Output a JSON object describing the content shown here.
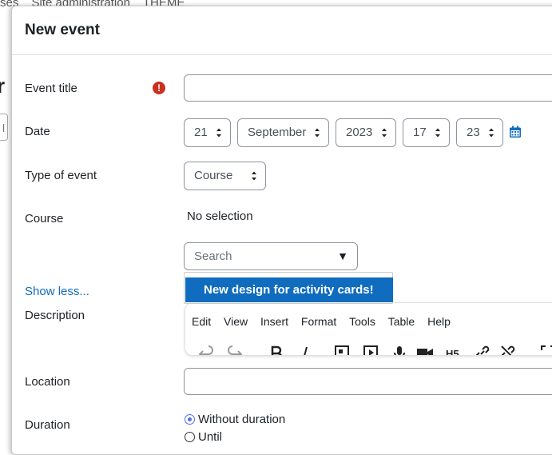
{
  "background": {
    "nav_items": [
      "ses",
      "Site administration",
      "THEME"
    ],
    "heading_fragment": "r",
    "box_fragment": "l c"
  },
  "modal": {
    "title": "New event",
    "event_title": {
      "label": "Event title",
      "value": "",
      "required_icon": "exclamation-circle-icon"
    },
    "date": {
      "label": "Date",
      "day": "21",
      "month": "September",
      "year": "2023",
      "hour": "17",
      "minute": "23",
      "calendar_icon": "calendar-icon"
    },
    "type_of_event": {
      "label": "Type of event",
      "value": "Course"
    },
    "course": {
      "label": "Course",
      "selection_text": "No selection",
      "search_placeholder": "Search",
      "dropdown_arrow": "▼",
      "suggestion": "New design for activity cards!"
    },
    "show_less": "Show less...",
    "description": {
      "label": "Description",
      "menu": [
        "Edit",
        "View",
        "Insert",
        "Format",
        "Tools",
        "Table",
        "Help"
      ]
    },
    "location": {
      "label": "Location",
      "value": ""
    },
    "duration": {
      "label": "Duration",
      "options": [
        {
          "label": "Without duration",
          "checked": true
        },
        {
          "label": "Until",
          "checked": false
        }
      ]
    }
  },
  "colors": {
    "link": "#0f6cbf",
    "selection_bg": "#0f6cbf",
    "required": "#ca3120",
    "radio_accent": "#4f6eea"
  }
}
